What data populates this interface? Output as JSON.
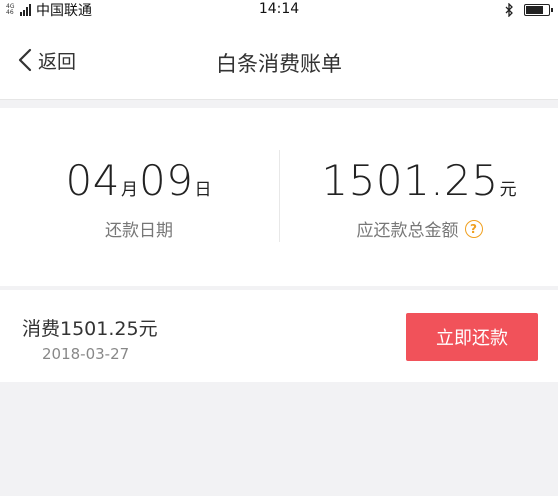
{
  "status_bar": {
    "network_type": "4G",
    "network_sub": "46",
    "carrier": "中国联通",
    "time": "14:14",
    "battery_level": 0.85,
    "bluetooth_icon": "bluetooth-icon"
  },
  "nav": {
    "back_label": "返回",
    "title": "白条消费账单"
  },
  "summary": {
    "due_month": "04",
    "month_unit": "月",
    "due_day": "09",
    "day_unit": "日",
    "due_label": "还款日期",
    "amount": "1501.25",
    "amount_unit": "元",
    "amount_label": "应还款总金额",
    "help_icon": "question-circle-icon"
  },
  "bill": {
    "title": "消费1501.25元",
    "date": "2018-03-27",
    "repay_button": "立即还款"
  },
  "colors": {
    "accent": "#f1525a",
    "help": "#f0a020",
    "background": "#f2f2f4"
  }
}
